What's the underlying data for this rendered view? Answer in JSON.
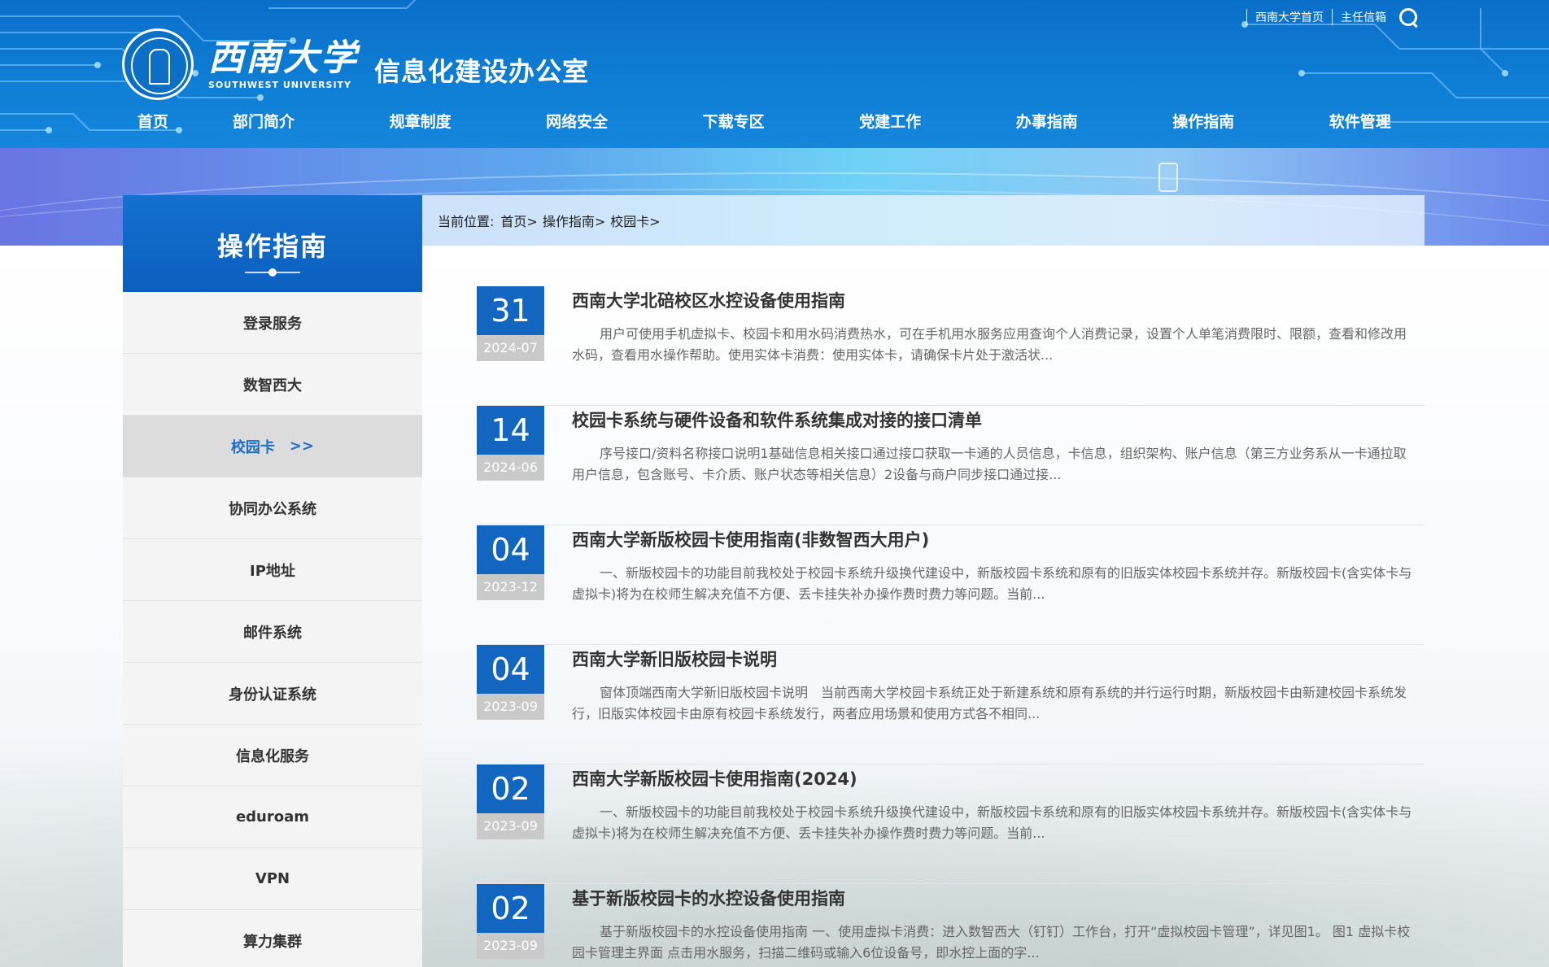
{
  "header": {
    "university_name_cn": "西南大学",
    "university_name_en": "SOUTHWEST UNIVERSITY",
    "office_title": "信息化建设办公室",
    "top_links": [
      "西南大学首页",
      "主任信箱"
    ],
    "search_icon": "search-icon"
  },
  "nav": {
    "items": [
      "首页",
      "部门简介",
      "规章制度",
      "网络安全",
      "下载专区",
      "党建工作",
      "办事指南",
      "操作指南",
      "软件管理"
    ]
  },
  "sidebar": {
    "title": "操作指南",
    "items": [
      {
        "label": "登录服务"
      },
      {
        "label": "数智西大"
      },
      {
        "label": "校园卡",
        "active": true,
        "arrow": ">>"
      },
      {
        "label": "协同办公系统"
      },
      {
        "label": "IP地址"
      },
      {
        "label": "邮件系统"
      },
      {
        "label": "身份认证系统"
      },
      {
        "label": "信息化服务"
      },
      {
        "label": "eduroam"
      },
      {
        "label": "VPN"
      },
      {
        "label": "算力集群"
      }
    ]
  },
  "breadcrumb": {
    "label": "当前位置:",
    "items": [
      "首页>",
      "操作指南>",
      "校园卡>"
    ]
  },
  "news": [
    {
      "day": "31",
      "ym": "2024-07",
      "title": "西南大学北碚校区水控设备使用指南",
      "desc": "用户可使用手机虚拟卡、校园卡和用水码消费热水，可在手机用水服务应用查询个人消费记录，设置个人单笔消费限时、限额，查看和修改用水码，查看用水操作帮助。使用实体卡消费：使用实体卡，请确保卡片处于激活状..."
    },
    {
      "day": "14",
      "ym": "2024-06",
      "title": "校园卡系统与硬件设备和软件系统集成对接的接口清单",
      "desc": "序号接口/资料名称接口说明1基础信息相关接口通过接口获取一卡通的人员信息，卡信息，组织架构、账户信息（第三方业务系从一卡通拉取用户信息，包含账号、卡介质、账户状态等相关信息）2设备与商户同步接口通过接..."
    },
    {
      "day": "04",
      "ym": "2023-12",
      "title": "西南大学新版校园卡使用指南(非数智西大用户)",
      "desc": "一、新版校园卡的功能目前我校处于校园卡系统升级换代建设中，新版校园卡系统和原有的旧版实体校园卡系统并存。新版校园卡(含实体卡与虚拟卡)将为在校师生解决充值不方便、丢卡挂失补办操作费时费力等问题。当前..."
    },
    {
      "day": "04",
      "ym": "2023-09",
      "title": "西南大学新旧版校园卡说明",
      "desc": "窗体顶端西南大学新旧版校园卡说明　当前西南大学校园卡系统正处于新建系统和原有系统的并行运行时期，新版校园卡由新建校园卡系统发行，旧版实体校园卡由原有校园卡系统发行，两者应用场景和使用方式各不相同..."
    },
    {
      "day": "02",
      "ym": "2023-09",
      "title": "西南大学新版校园卡使用指南(2024)",
      "desc": "一、新版校园卡的功能目前我校处于校园卡系统升级换代建设中，新版校园卡系统和原有的旧版实体校园卡系统并存。新版校园卡(含实体卡与虚拟卡)将为在校师生解决充值不方便、丢卡挂失补办操作费时费力等问题。当前..."
    },
    {
      "day": "02",
      "ym": "2023-09",
      "title": "基于新版校园卡的水控设备使用指南",
      "desc": "基于新版校园卡的水控设备使用指南 一、使用虚拟卡消费：进入数智西大（钉钉）工作台，打开“虚拟校园卡管理”，详见图1。 图1 虚拟卡校园卡管理主界面 点击用水服务，扫描二维码或输入6位设备号，即水控上面的字..."
    }
  ],
  "colors": {
    "header_blue": "#0f7fd6",
    "date_blue": "#1266bf",
    "date_gray": "#c9c9c9",
    "active_text": "#1a6fc9"
  }
}
